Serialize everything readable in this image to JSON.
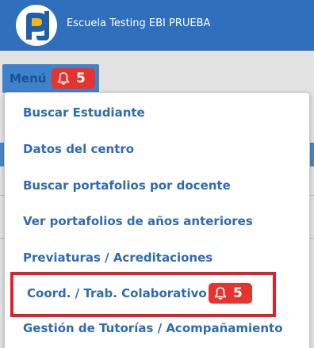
{
  "header": {
    "school_name": "Escuela Testing EBI PRUEBA",
    "background_color": "#2f6fbb",
    "logo_icon": "pd-logo-icon"
  },
  "menu": {
    "label": "Menú",
    "badge_count": "5",
    "badge_icon": "bell-icon",
    "badge_color": "#e4342d"
  },
  "dropdown": {
    "items": [
      {
        "label": "Buscar Estudiante"
      },
      {
        "label": "Datos del centro"
      },
      {
        "label": "Buscar portafolios por docente"
      },
      {
        "label": "Ver portafolios de años anteriores"
      },
      {
        "label": "Previaturas / Acreditaciones"
      },
      {
        "label": "Coord. / Trab. Colaborativo",
        "badge_count": "5",
        "highlighted": true
      },
      {
        "label": "Gestión de Tutorías / Acompañamiento"
      }
    ],
    "item_color": "#2e6bb0",
    "highlight_color": "#e0202a"
  }
}
